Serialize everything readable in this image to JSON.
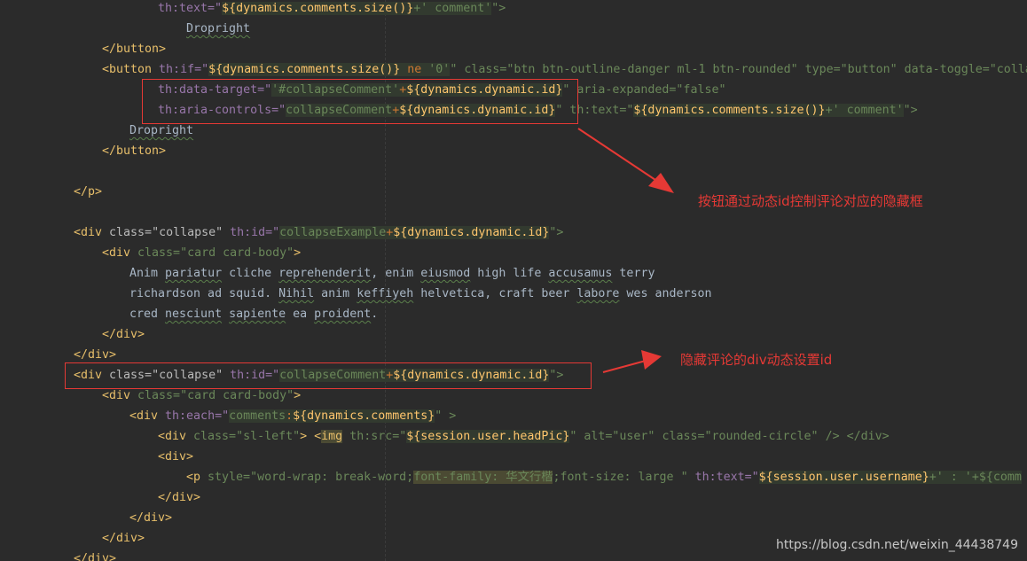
{
  "annotations": {
    "note1": "按钮通过动态id控制评论对应的隐藏框",
    "note2": "隐藏评论的div动态设置id"
  },
  "watermark": "https://blog.csdn.net/weixin_44438749",
  "code": {
    "l1": {
      "a": "th:text=\"",
      "b": "${dynamics.comments.size()}",
      "c": "+' comment'",
      "d": "\">"
    },
    "l2": {
      "a": "Dropright"
    },
    "l3": {
      "a": "</button>"
    },
    "l4": {
      "a": "<button ",
      "b": "th:if=\"",
      "c": "${dynamics.comments.size()}",
      "d": " ne ",
      "e": "'0'",
      "f": "\" class=\"btn btn-outline-danger ml-1 btn-rounded\" type=\"button\" data-toggle=\"colla"
    },
    "l5": {
      "a": "th:data-target=\"",
      "b": "'#collapseComment'",
      "c": "+",
      "d": "${dynamics.dynamic.id}",
      "e": "\" aria-expanded=\"false\""
    },
    "l6": {
      "a": "th:aria-controls=\"",
      "b": "collapseComment",
      "c": "+",
      "d": "${dynamics.dynamic.id}",
      "e": "\" th:text=\"",
      "f": "${dynamics.comments.size()}",
      "g": "+' comment'",
      "h": "\">"
    },
    "l7": {
      "a": "Dropright"
    },
    "l8": {
      "a": "</button>"
    },
    "l9": {
      "a": "</p>"
    },
    "l10": {
      "a": "<div ",
      "b": "class=\"collapse\" ",
      "c": "th:id=\"",
      "d": "collapseExample",
      "e": "+",
      "f": "${dynamics.dynamic.id}",
      "g": "\">"
    },
    "l11": {
      "a": "<div ",
      "b": "class=\"card card-body\"",
      "c": ">"
    },
    "l12": {
      "a": "Anim ",
      "b": "pariatur",
      "c": " cliche ",
      "d": "reprehenderit",
      "e": ", enim ",
      "f": "eiusmod",
      "g": " high life ",
      "h": "accusamus",
      "i": " terry"
    },
    "l13": {
      "a": "richardson ad squid. ",
      "b": "Nihil",
      "c": " anim ",
      "d": "keffiyeh",
      "e": " helvetica, craft beer ",
      "f": "labore",
      "g": " wes anderson"
    },
    "l14": {
      "a": "cred ",
      "b": "nesciunt",
      "c": " ",
      "d": "sapiente",
      "e": " ea ",
      "f": "proident",
      "g": "."
    },
    "l15": {
      "a": "</div>"
    },
    "l16": {
      "a": "</div>"
    },
    "l17": {
      "a": "<div ",
      "b": "class=\"collapse\" ",
      "c": "th:id=\"",
      "d": "collapseComment",
      "e": "+",
      "f": "${dynamics.dynamic.id}",
      "g": "\">"
    },
    "l18": {
      "a": "<div ",
      "b": "class=\"card card-body\"",
      "c": ">"
    },
    "l19": {
      "a": "<div ",
      "b": "th:each=\"",
      "c": "comments",
      "d": ":",
      "e": "${dynamics.comments}",
      "f": "\" >"
    },
    "l20": {
      "a": "<div ",
      "b": "class=\"sl-left\"",
      "c": "> <",
      "d": "img",
      "e": " th:src=\"",
      "f": "${session.user.headPic}",
      "g": "\" alt=\"user\" class=\"rounded-circle\" /> </div>"
    },
    "l21": {
      "a": "<div>"
    },
    "l22": {
      "a": "<p ",
      "b": "style=\"word-wrap: break-word;",
      "c": "font-family: 华文行楷",
      "d": ";font-size: large \" ",
      "e": "th:text=\"",
      "f": "${session.user.username}",
      "g": "+' : '+${comm"
    },
    "l23": {
      "a": "</div>"
    },
    "l24": {
      "a": "</div>"
    },
    "l25": {
      "a": "</div>"
    },
    "l26": {
      "a": "</div>"
    }
  }
}
